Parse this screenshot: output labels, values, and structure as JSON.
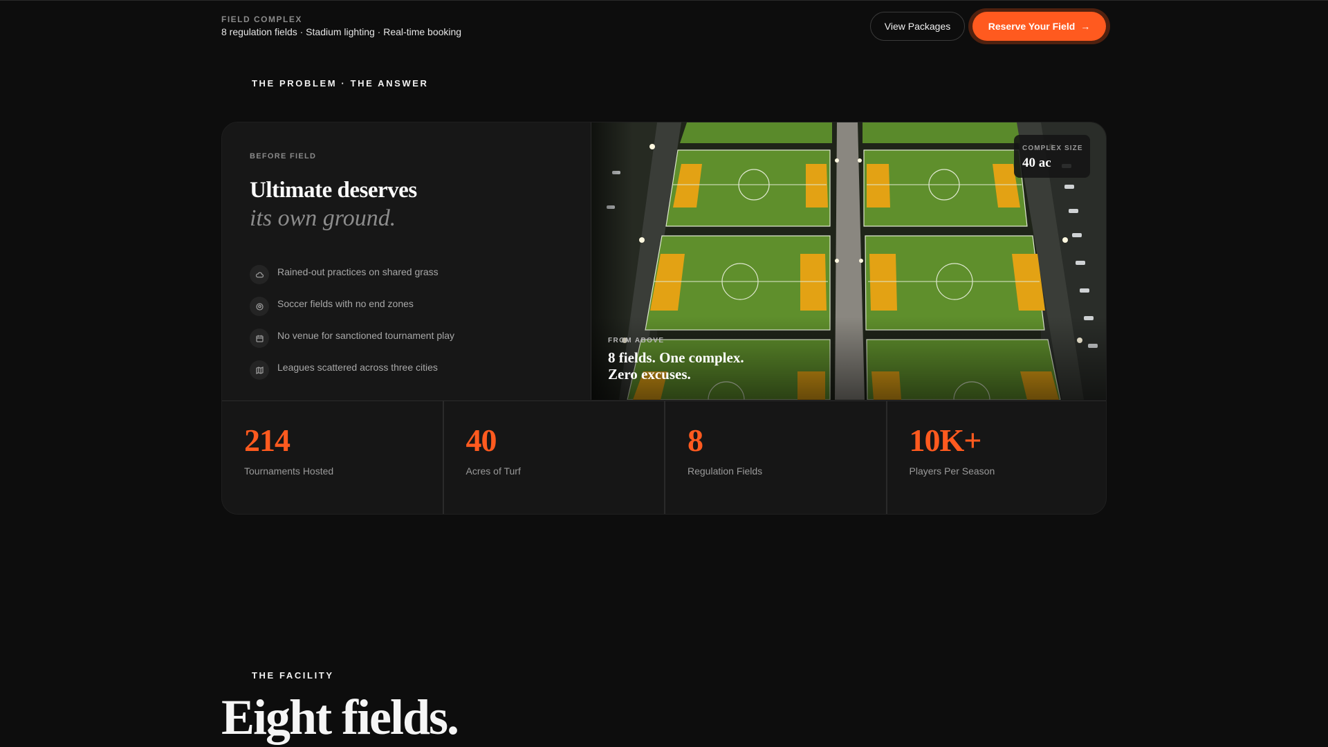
{
  "header": {
    "eyebrow": "FIELD COMPLEX",
    "subtitle": "8 regulation fields · Stadium lighting · Real-time booking",
    "view_packages": "View Packages",
    "reserve": "Reserve Your Field",
    "reserve_icon": "arrow-right-icon"
  },
  "problem_section": {
    "eyebrow": "THE PROBLEM · THE ANSWER",
    "before_label": "BEFORE FIELD",
    "title_line1": "Ultimate deserves",
    "title_line2": "its own ground.",
    "pain_points": [
      {
        "icon": "cloud-icon",
        "text": "Rained-out practices on shared grass"
      },
      {
        "icon": "soccer-ball-icon",
        "text": "Soccer fields with no end zones"
      },
      {
        "icon": "calendar-icon",
        "text": "No venue for sanctioned tournament play"
      },
      {
        "icon": "map-icon",
        "text": "Leagues scattered across three cities"
      }
    ],
    "photo": {
      "badge_label": "COMPLEX SIZE",
      "badge_value": "40 ac",
      "caption_label": "FROM ABOVE",
      "caption_line1": "8 fields. One complex.",
      "caption_line2": "Zero excuses."
    },
    "stats": [
      {
        "value": "214",
        "label": "Tournaments Hosted"
      },
      {
        "value": "40",
        "label": "Acres of Turf"
      },
      {
        "value": "8",
        "label": "Regulation Fields"
      },
      {
        "value": "10K+",
        "label": "Players Per Season"
      }
    ]
  },
  "facility_section": {
    "eyebrow": "THE FACILITY",
    "title": "Eight fields."
  },
  "colors": {
    "accent": "#ff5a1f",
    "background": "#0d0d0d",
    "card": "#161616",
    "turf": "#5f8f2c",
    "endzone": "#e3a214"
  }
}
